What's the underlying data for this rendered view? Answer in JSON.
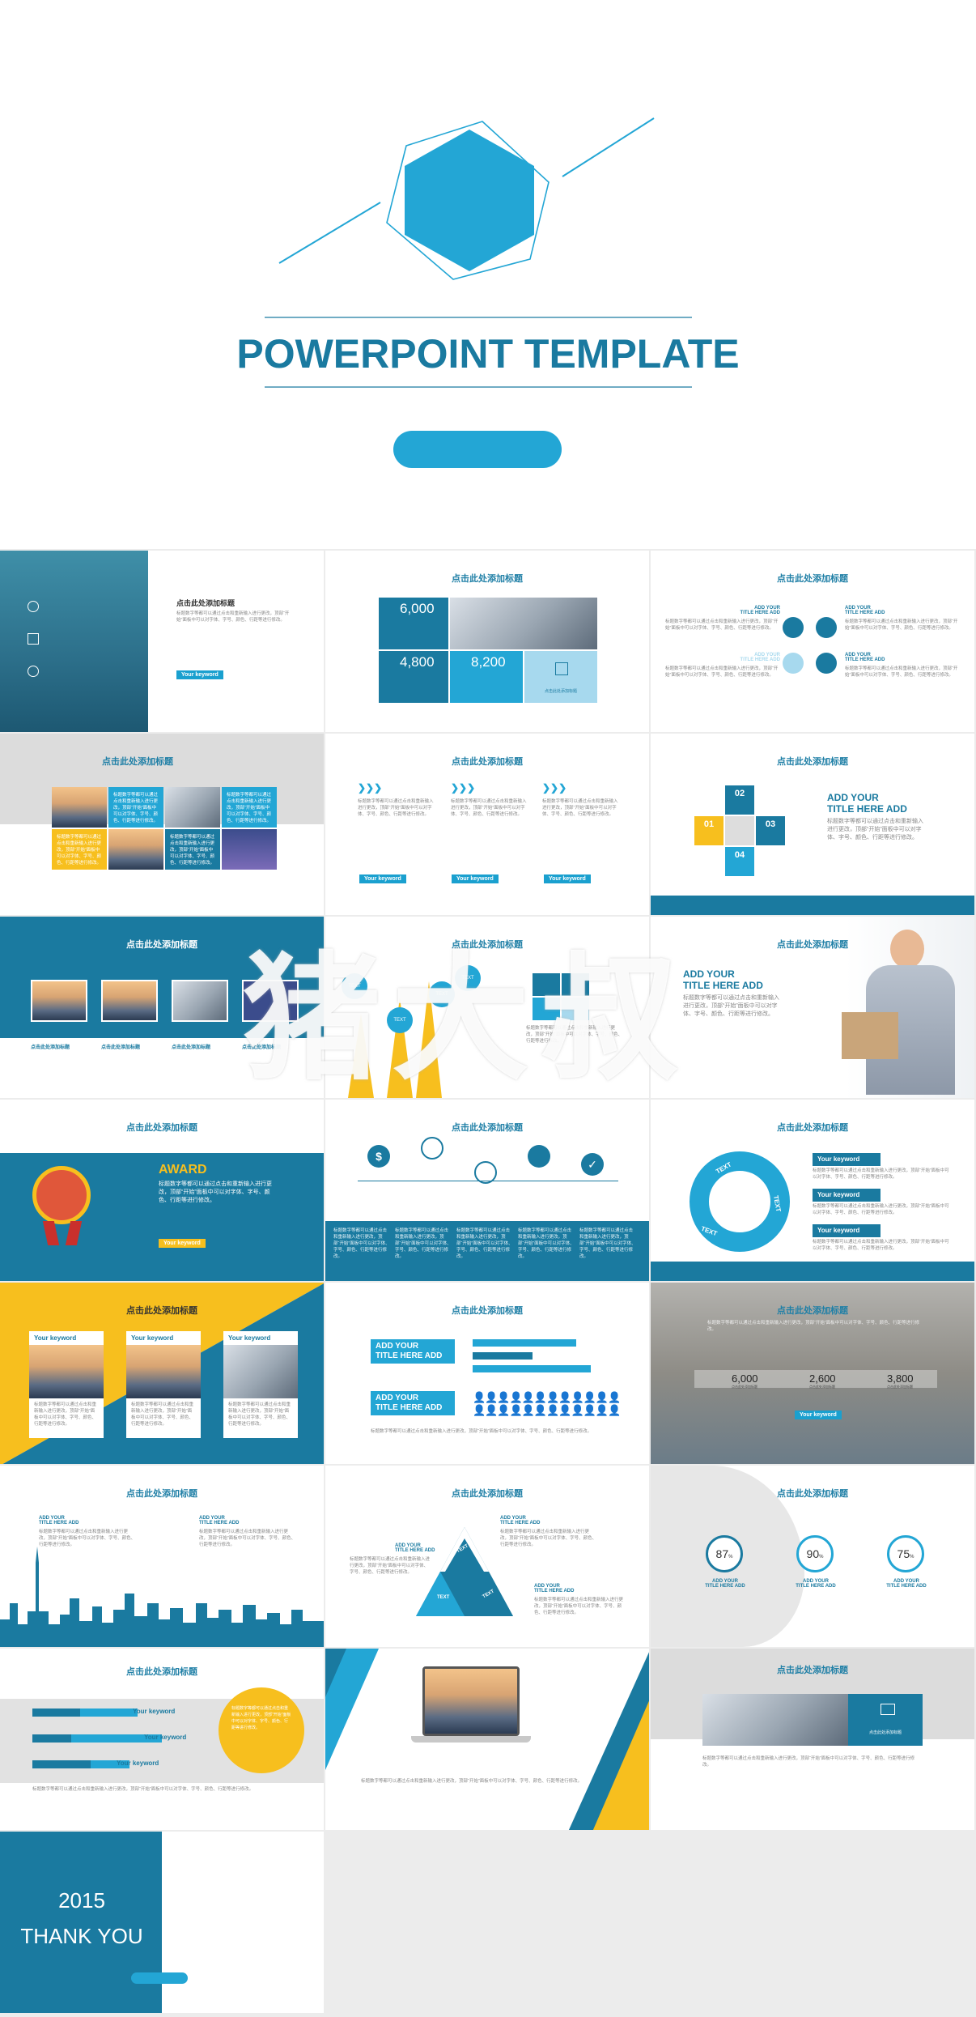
{
  "cover": {
    "title": "POWERPOINT TEMPLATE"
  },
  "common": {
    "slide_title": "点击此处添加标题",
    "body_text": "标题数字等都可以通过点击和重新输入进行更改，顶部“开始”面板中可以对字体、字号、颜色、行距等进行修改。",
    "keyword": "Your keyword",
    "keyword_label": "Your keyword",
    "add_title_1": "ADD YOUR",
    "add_title_2": "TITLE HERE ADD",
    "text_badge": "TEXT"
  },
  "slide4": {
    "n1": "6,000",
    "n2": "4,800",
    "n3": "8,200",
    "caption": "点击此处添加标题"
  },
  "slide9": {
    "n1": "02",
    "n2": "01",
    "n3": "03",
    "n4": "04"
  },
  "slide13": {
    "award": "AWARD"
  },
  "slide20": {
    "n1": "6,000",
    "n2": "2,600",
    "n3": "3,800",
    "unit": "点击此处添加标题"
  },
  "slide24": {
    "p1": "87",
    "p2": "90",
    "p3": "75",
    "pct": "%"
  },
  "slide27": {
    "caption": "点击此处添加标题"
  },
  "thanks": {
    "year": "2015",
    "text": "THANK YOU"
  },
  "watermark": "猪大叔",
  "colors": {
    "primary": "#1a7aa0",
    "accent": "#23a6d5",
    "yellow": "#f7bf1e"
  }
}
